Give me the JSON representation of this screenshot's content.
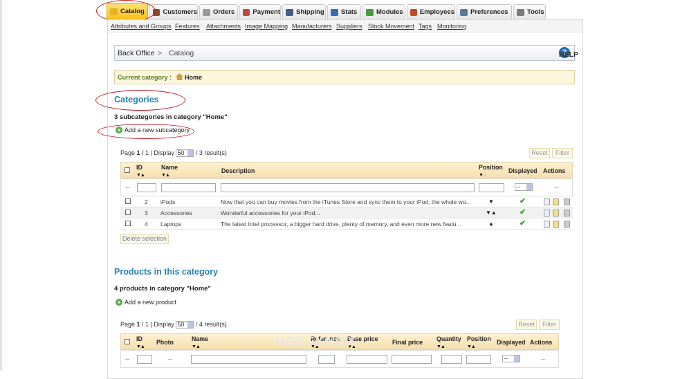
{
  "tabs": [
    {
      "label": "Catalog",
      "color": "#d29a10"
    },
    {
      "label": "Customers",
      "color": "#8a4a2a"
    },
    {
      "label": "Orders",
      "color": "#888888"
    },
    {
      "label": "Payment",
      "color": "#b83a2a"
    },
    {
      "label": "Shipping",
      "color": "#4a5a8a"
    },
    {
      "label": "Stats",
      "color": "#3a6ab8"
    },
    {
      "label": "Modules",
      "color": "#4a9a3a"
    },
    {
      "label": "Employees",
      "color": "#c04a2a"
    },
    {
      "label": "Preferences",
      "color": "#5a7a9a"
    },
    {
      "label": "Tools",
      "color": "#7a7a7a"
    }
  ],
  "subnav": [
    "Attributes and Groups",
    "Features",
    "Attachments",
    "Image Mapping",
    "Manufacturers",
    "Suppliers",
    "Stock Movement",
    "Tags",
    "Monitoring"
  ],
  "breadcrumb": {
    "root": "Back Office",
    "sep": ">",
    "current": "Catalog",
    "help": "HELP"
  },
  "current_category": {
    "label": "Current category :",
    "value": "Home"
  },
  "categories": {
    "title": "Categories",
    "count_text": "3 subcategories in category \"Home\"",
    "add_label": "Add a new subcategory",
    "pager": {
      "prefix": "Page ",
      "page": "1",
      "mid": " / 1 | Display ",
      "per_page": "50",
      "suffix": " / 3 result(s)"
    },
    "reset": "Reset",
    "filter": "Filter",
    "columns": {
      "id": "ID",
      "name": "Name",
      "description": "Description",
      "position": "Position",
      "displayed": "Displayed",
      "actions": "Actions"
    },
    "filter_dash": "--",
    "filter_select": "--",
    "rows": [
      {
        "id": "2",
        "name": "iPods",
        "description": "Now that you can buy movies from the iTunes Store and sync them to your iPod, the whole wo...",
        "position": "▼"
      },
      {
        "id": "3",
        "name": "Accessories",
        "description": "Wonderful accessories for your iPod...",
        "position": "▼▲"
      },
      {
        "id": "4",
        "name": "Laptops",
        "description": "The latest Intel processor, a bigger hard drive, plenty of memory, and even more new featu...",
        "position": "▲"
      }
    ],
    "delete_label": "Delete selection"
  },
  "products": {
    "title": "Products in this category",
    "count_text": "4 products in category \"Home\"",
    "add_label": "Add a new product",
    "pager": {
      "prefix": "Page ",
      "page": "1",
      "mid": " / 1 | Display ",
      "per_page": "50",
      "suffix": " / 4 result(s)"
    },
    "reset": "Reset",
    "filter": "Filter",
    "columns": {
      "id": "ID",
      "photo": "Photo",
      "name": "Name",
      "reference": "Reference",
      "base_price": "Base price",
      "final_price": "Final price",
      "quantity": "Quantity",
      "position": "Position",
      "displayed": "Displayed",
      "actions": "Actions"
    },
    "filter_dash": "--",
    "filter_select": "--"
  },
  "watermark": "HOSTKNOX"
}
